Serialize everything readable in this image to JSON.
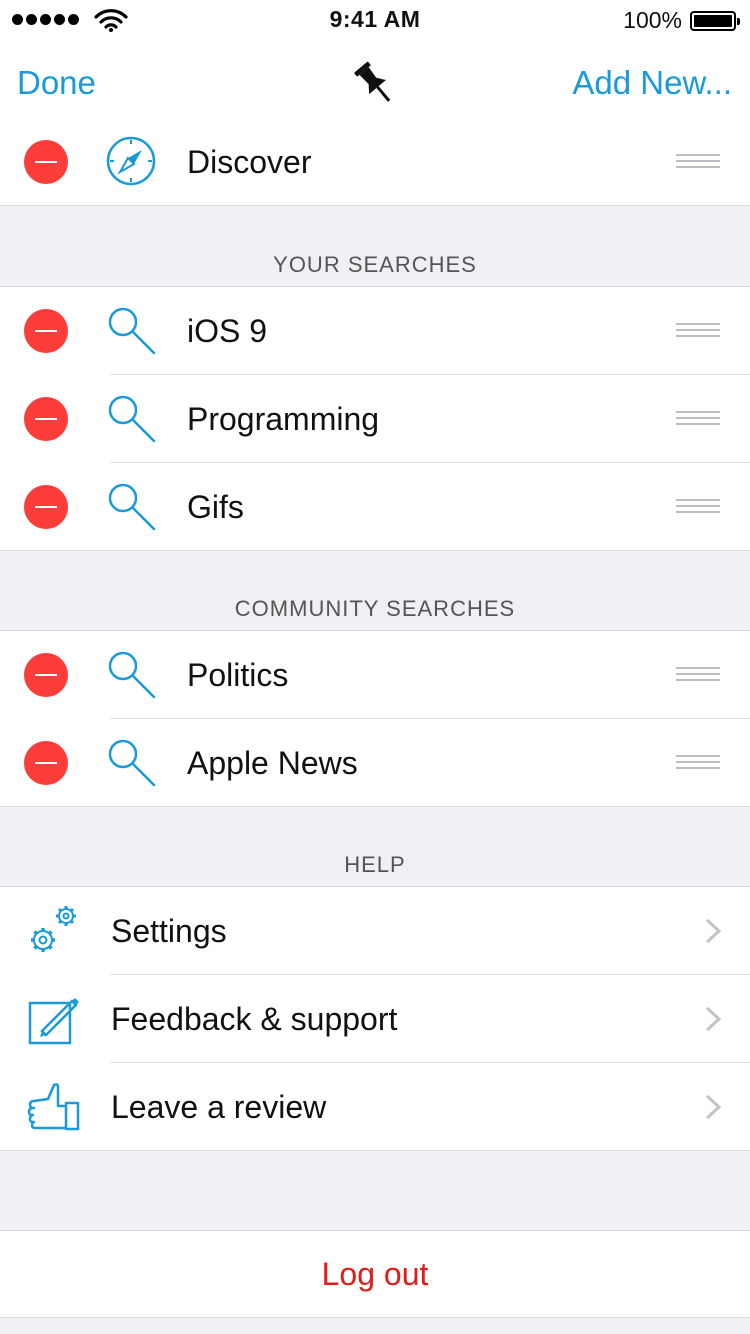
{
  "status_bar": {
    "time": "9:41 AM",
    "battery": "100%"
  },
  "navbar": {
    "left_label": "Done",
    "right_label": "Add New...",
    "center_icon": "pushpin-icon"
  },
  "pinned": {
    "items": [
      {
        "label": "Discover",
        "icon": "compass-icon"
      }
    ]
  },
  "your_searches": {
    "header": "YOUR SEARCHES",
    "items": [
      {
        "label": "iOS 9",
        "icon": "search-icon"
      },
      {
        "label": "Programming",
        "icon": "search-icon"
      },
      {
        "label": "Gifs",
        "icon": "search-icon"
      }
    ]
  },
  "community_searches": {
    "header": "COMMUNITY SEARCHES",
    "items": [
      {
        "label": "Politics",
        "icon": "search-icon"
      },
      {
        "label": "Apple News",
        "icon": "search-icon"
      }
    ]
  },
  "help": {
    "header": "HELP",
    "items": [
      {
        "label": "Settings",
        "icon": "gears-icon"
      },
      {
        "label": "Feedback & support",
        "icon": "edit-icon"
      },
      {
        "label": "Leave a review",
        "icon": "thumbs-up-icon"
      }
    ]
  },
  "logout": {
    "label": "Log out"
  },
  "colors": {
    "accent": "#1a9ad9",
    "delete": "#fc3d39",
    "logout": "#e21b1b",
    "background": "#efeff4"
  }
}
